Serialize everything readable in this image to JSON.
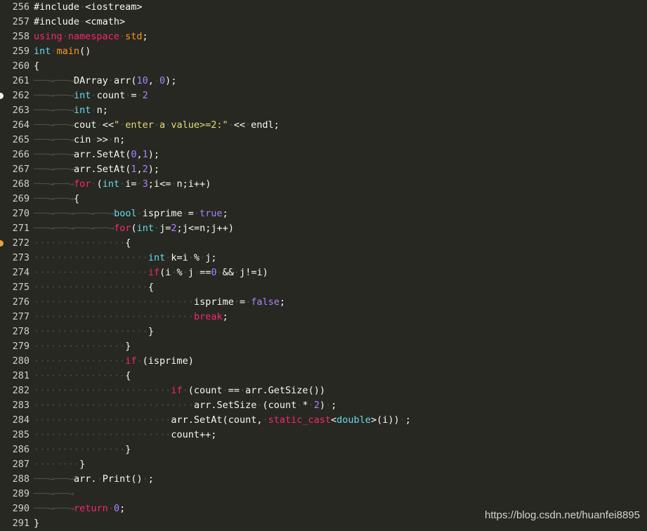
{
  "editor": {
    "lines": [
      {
        "num": "256",
        "code": "#include <iostream>"
      },
      {
        "num": "257",
        "code": "#include <cmath>"
      },
      {
        "num": "258",
        "code": "using namespace std;"
      },
      {
        "num": "259",
        "code": "int main()"
      },
      {
        "num": "260",
        "code": "{"
      },
      {
        "num": "261",
        "code": "\t\tDArray arr(10, 0);"
      },
      {
        "num": "262",
        "code": "\t\tint count = 2",
        "marker": "white"
      },
      {
        "num": "263",
        "code": "\t\tint n;"
      },
      {
        "num": "264",
        "code": "\t\tcout <<\" enter a value>=2:\" << endl;"
      },
      {
        "num": "265",
        "code": "\t\tcin >> n;"
      },
      {
        "num": "266",
        "code": "\t\tarr.SetAt(0,1);"
      },
      {
        "num": "267",
        "code": "\t\tarr.SetAt(1,2);"
      },
      {
        "num": "268",
        "code": "\t\tfor (int i= 3;i<= n;i++)"
      },
      {
        "num": "269",
        "code": "\t\t{"
      },
      {
        "num": "270",
        "code": "\t\t\t\tbool isprime = true;"
      },
      {
        "num": "271",
        "code": "\t\t\t\tfor(int j=2;j<=n;j++)"
      },
      {
        "num": "272",
        "code": "                {",
        "marker": "orange"
      },
      {
        "num": "273",
        "code": "                    int k=i % j;"
      },
      {
        "num": "274",
        "code": "                    if(i % j ==0 && j!=i)"
      },
      {
        "num": "275",
        "code": "                    {"
      },
      {
        "num": "276",
        "code": "                            isprime = false;"
      },
      {
        "num": "277",
        "code": "                            break;"
      },
      {
        "num": "278",
        "code": "                    }"
      },
      {
        "num": "279",
        "code": "                }"
      },
      {
        "num": "280",
        "code": "                if (isprime)"
      },
      {
        "num": "281",
        "code": "                {"
      },
      {
        "num": "282",
        "code": "                        if (count == arr.GetSize())"
      },
      {
        "num": "283",
        "code": "                            arr.SetSize (count * 2) ;"
      },
      {
        "num": "284",
        "code": "                        arr.SetAt(count, static_cast<double>(i)) ;"
      },
      {
        "num": "285",
        "code": "                        count++;"
      },
      {
        "num": "286",
        "code": "                }"
      },
      {
        "num": "287",
        "code": "        }"
      },
      {
        "num": "288",
        "code": "\t\tarr. Print() ;"
      },
      {
        "num": "289",
        "code": "\t\t"
      },
      {
        "num": "290",
        "code": "\t\treturn 0;"
      },
      {
        "num": "291",
        "code": "}"
      }
    ]
  },
  "watermark": "https://blog.csdn.net/huanfei8895",
  "theme": {
    "background": "#272822",
    "keyword": "#f92672",
    "type": "#66d9ef",
    "number": "#ae81ff",
    "string": "#e6db74",
    "whitespace": "#4e4e44",
    "marker_white": "#f0f0f0",
    "marker_orange": "#e8a33d"
  }
}
